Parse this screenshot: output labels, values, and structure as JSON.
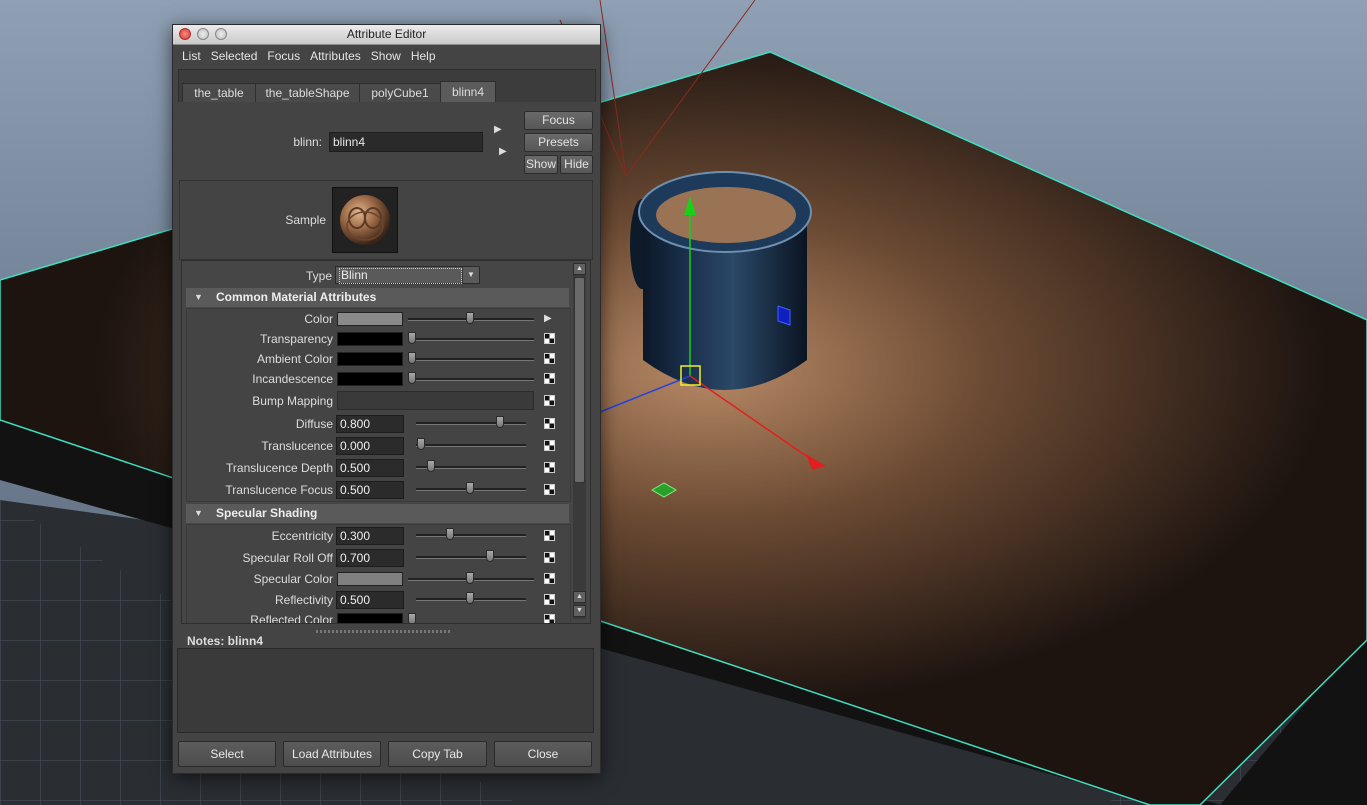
{
  "window": {
    "title": "Attribute Editor"
  },
  "menu": [
    "List",
    "Selected",
    "Focus",
    "Attributes",
    "Show",
    "Help"
  ],
  "tabs": [
    "the_table",
    "the_tableShape",
    "polyCube1",
    "blinn4"
  ],
  "active_tab": "blinn4",
  "node": {
    "label": "blinn:",
    "value": "blinn4"
  },
  "side_buttons": {
    "focus": "Focus",
    "presets": "Presets",
    "show": "Show",
    "hide": "Hide"
  },
  "sample": {
    "label": "Sample"
  },
  "type": {
    "label": "Type",
    "value": "Blinn"
  },
  "sections": {
    "common": "Common Material Attributes",
    "specular": "Specular Shading"
  },
  "common_attrs": {
    "color": "Color",
    "transparency": "Transparency",
    "ambient": "Ambient Color",
    "incandescence": "Incandescence",
    "bump": "Bump Mapping",
    "diffuse": {
      "label": "Diffuse",
      "value": "0.800"
    },
    "translucence": {
      "label": "Translucence",
      "value": "0.000"
    },
    "trans_depth": {
      "label": "Translucence Depth",
      "value": "0.500"
    },
    "trans_focus": {
      "label": "Translucence Focus",
      "value": "0.500"
    }
  },
  "specular_attrs": {
    "eccentricity": {
      "label": "Eccentricity",
      "value": "0.300"
    },
    "rolloff": {
      "label": "Specular Roll Off",
      "value": "0.700"
    },
    "spec_color": "Specular Color",
    "reflectivity": {
      "label": "Reflectivity",
      "value": "0.500"
    },
    "reflected": "Reflected Color"
  },
  "notes": {
    "label": "Notes:  blinn4"
  },
  "bottom_buttons": [
    "Select",
    "Load Attributes",
    "Copy Tab",
    "Close"
  ],
  "colors": {
    "color_swatch": "#8a8a8a",
    "transparency_swatch": "#000000",
    "ambient_swatch": "#000000",
    "incandescence_swatch": "#000000",
    "spec_color_swatch": "#808080",
    "reflected_swatch": "#000000"
  }
}
